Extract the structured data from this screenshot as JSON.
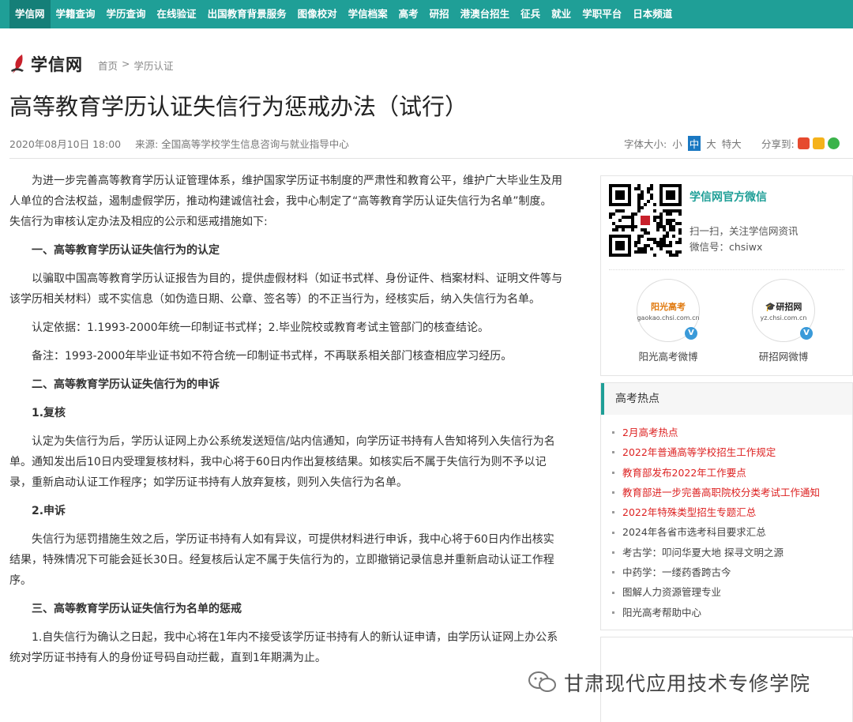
{
  "topnav": [
    "学信网",
    "学籍查询",
    "学历查询",
    "在线验证",
    "出国教育背景服务",
    "图像校对",
    "学信档案",
    "高考",
    "研招",
    "港澳台招生",
    "征兵",
    "就业",
    "学职平台",
    "日本频道"
  ],
  "logo": {
    "text": "学信网"
  },
  "breadcrumb": {
    "home": "首页",
    "sep": ">",
    "current": "学历认证"
  },
  "title": "高等教育学历认证失信行为惩戒办法（试行）",
  "meta": {
    "date": "2020年08月10日 18:00",
    "source": "来源:  全国高等学校学生信息咨询与就业指导中心"
  },
  "fontsize": {
    "label": "字体大小:",
    "small": "小",
    "medium": "中",
    "large": "大",
    "xlarge": "特大"
  },
  "share": {
    "label": "分享到:"
  },
  "article": [
    {
      "kind": "p",
      "text": "为进一步完善高等教育学历认证管理体系，维护国家学历证书制度的严肃性和教育公平，维护广大毕业生及用人单位的合法权益，遏制虚假学历，推动构建诚信社会，我中心制定了“高等教育学历认证失信行为名单”制度。失信行为审核认定办法及相应的公示和惩戒措施如下:"
    },
    {
      "kind": "h",
      "text": "一、高等教育学历认证失信行为的认定"
    },
    {
      "kind": "p",
      "text": "以骗取中国高等教育学历认证报告为目的，提供虚假材料（如证书式样、身份证件、档案材料、证明文件等与该学历相关材料）或不实信息（如伪造日期、公章、签名等）的不正当行为，经核实后，纳入失信行为名单。"
    },
    {
      "kind": "p",
      "text": "认定依据：1.1993-2000年统一印制证书式样；2.毕业院校或教育考试主管部门的核查结论。"
    },
    {
      "kind": "p",
      "text": "备注：1993-2000年毕业证书如不符合统一印制证书式样，不再联系相关部门核查相应学习经历。"
    },
    {
      "kind": "h",
      "text": "二、高等教育学历认证失信行为的申诉"
    },
    {
      "kind": "h",
      "text": "1.复核"
    },
    {
      "kind": "p",
      "text": "认定为失信行为后，学历认证网上办公系统发送短信/站内信通知，向学历证书持有人告知将列入失信行为名单。通知发出后10日内受理复核材料，我中心将于60日内作出复核结果。如核实后不属于失信行为则不予以记录，重新启动认证工作程序；如学历证书持有人放弃复核，则列入失信行为名单。"
    },
    {
      "kind": "h",
      "text": "2.申诉"
    },
    {
      "kind": "p",
      "text": "失信行为惩罚措施生效之后，学历证书持有人如有异议，可提供材料进行申诉，我中心将于60日内作出核实结果，特殊情况下可能会延长30日。经复核后认定不属于失信行为的，立即撤销记录信息并重新启动认证工作程序。"
    },
    {
      "kind": "h",
      "text": "三、高等教育学历认证失信行为名单的惩戒"
    },
    {
      "kind": "p",
      "text": "1.自失信行为确认之日起，我中心将在1年内不接受该学历证书持有人的新认证申请，由学历认证网上办公系统对学历证书持有人的身份证号码自动拦截，直到1年期满为止。"
    }
  ],
  "wechat": {
    "title": "学信网官方微信",
    "line1": "扫一扫，关注学信网资讯",
    "line2": "微信号：chsiwx"
  },
  "weibo": [
    {
      "brand": "阳光高考",
      "url": "gaokao.chsi.com.cn",
      "label": "阳光高考微博"
    },
    {
      "brand": "研招网",
      "url": "yz.chsi.com.cn",
      "label": "研招网微博"
    }
  ],
  "hot": {
    "title": "高考热点",
    "items": [
      {
        "text": "2月高考热点",
        "red": true
      },
      {
        "text": "2022年普通高等学校招生工作规定",
        "red": true
      },
      {
        "text": "教育部发布2022年工作要点",
        "red": true
      },
      {
        "text": "教育部进一步完善高职院校分类考试工作通知",
        "red": true
      },
      {
        "text": "2022年特殊类型招生专题汇总",
        "red": true
      },
      {
        "text": "2024年各省市选考科目要求汇总",
        "red": false
      },
      {
        "text": "考古学：叩问华夏大地 探寻文明之源",
        "red": false
      },
      {
        "text": "中药学：一缕药香跨古今",
        "red": false
      },
      {
        "text": "图解人力资源管理专业",
        "red": false
      },
      {
        "text": "阳光高考帮助中心",
        "red": false
      }
    ]
  },
  "watermark": {
    "text": "甘肃现代应用技术专修学院"
  },
  "colors": {
    "nav": "#1f9f97",
    "nav_active": "#157f78",
    "accent": "#1f9f97",
    "hot_red": "#d22222",
    "fontsize_selected": "#1a78c2"
  }
}
